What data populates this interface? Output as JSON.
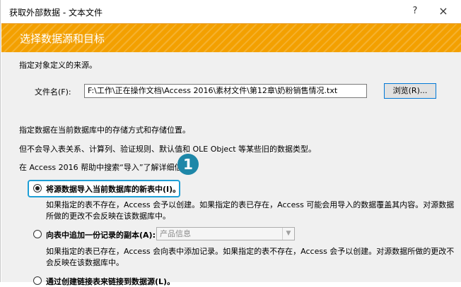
{
  "window": {
    "title": "获取外部数据 - 文本文件",
    "help": "?",
    "close": "×"
  },
  "banner": {
    "title": "选择数据源和目标"
  },
  "source": {
    "prompt": "指定对象定义的来源。",
    "file_label": "文件名(F):",
    "file_value": "F:\\工作\\正在操作文档\\Access 2016\\素材文件\\第12章\\奶粉销售情况.txt",
    "browse_label": "浏览(R)..."
  },
  "info": {
    "line1": "指定数据在当前数据库中的存储方式和存储位置。",
    "line2": "但不会导入表关系、计算列、验证规则、默认值和 OLE Object 等某些旧的数据类型。",
    "line3": "在 Access 2016 帮助中搜索“导入”了解详细信息。"
  },
  "callout": "1",
  "options": [
    {
      "label": "将源数据导入当前数据库的新表中(I)。",
      "checked": true,
      "desc1": "如果指定的表不存在，Access 会予以创建。如果指定的表已存在，Access 可能会用导入的数据覆盖其内容。对源数据",
      "desc2": "所做的更改不会反映在该数据库中。"
    },
    {
      "label": "向表中追加一份记录的副本(A):",
      "checked": false,
      "combo_value": "产品信息",
      "desc1": "如果指定的表已存在，Access 会向表中添加记录。如果指定的表不存在，Access 会予以创建。对源数据所做的更改不",
      "desc2": "会反映在该数据库中。"
    },
    {
      "label": "通过创建链接表来链接到数据源(L)。",
      "checked": false
    }
  ]
}
